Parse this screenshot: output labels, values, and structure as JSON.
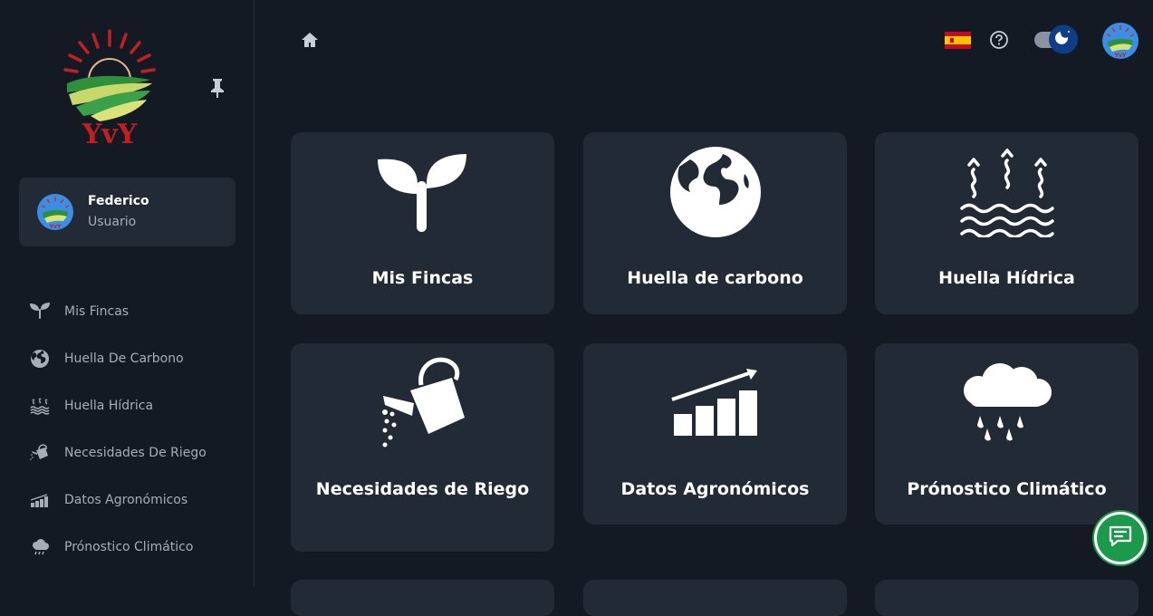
{
  "sidebar": {
    "user": {
      "name": "Federico",
      "role": "Usuario"
    },
    "items": [
      {
        "label": "Mis Fincas",
        "icon": "sprout-icon"
      },
      {
        "label": "Huella De Carbono",
        "icon": "globe-icon"
      },
      {
        "label": "Huella Hídrica",
        "icon": "water-steam-icon"
      },
      {
        "label": "Necesidades De Riego",
        "icon": "watering-can-icon"
      },
      {
        "label": "Datos Agronómicos",
        "icon": "bar-chart-icon"
      },
      {
        "label": "Prónostico Climático",
        "icon": "rain-cloud-icon"
      }
    ]
  },
  "cards": [
    {
      "label": "Mis Fincas",
      "icon": "sprout-icon"
    },
    {
      "label": "Huella de carbono",
      "icon": "globe-icon"
    },
    {
      "label": "Huella Hídrica",
      "icon": "water-steam-icon"
    },
    {
      "label": "Necesidades de Riego",
      "icon": "watering-can-icon"
    },
    {
      "label": "Datos Agronómicos",
      "icon": "growth-chart-icon"
    },
    {
      "label": "Prónostico Climático",
      "icon": "rain-cloud-icon"
    }
  ],
  "colors": {
    "background": "#141a23",
    "card": "#222a35",
    "muted_text": "#a5adb9",
    "chat": "#1a9a4a",
    "logo_red": "#c0201f",
    "logo_green": "#2f8f3a"
  }
}
